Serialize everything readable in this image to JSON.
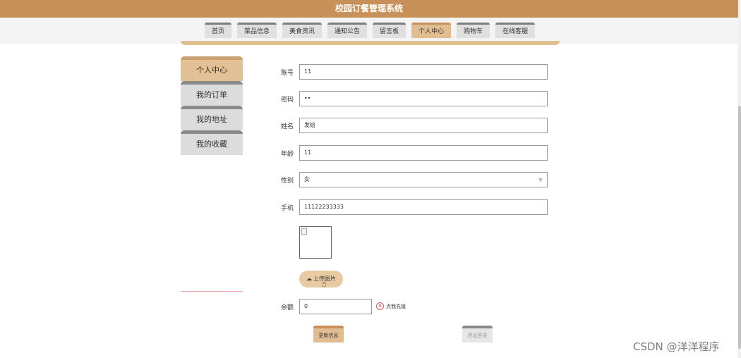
{
  "header": {
    "title": "校园订餐管理系统"
  },
  "nav": [
    {
      "label": "首页"
    },
    {
      "label": "菜品信息"
    },
    {
      "label": "美食资讯"
    },
    {
      "label": "通知公告"
    },
    {
      "label": "留言板"
    },
    {
      "label": "个人中心",
      "active": true
    },
    {
      "label": "购物车"
    },
    {
      "label": "在线客服"
    }
  ],
  "sidebar": [
    {
      "label": "个人中心",
      "active": true
    },
    {
      "label": "我的订单"
    },
    {
      "label": "我的地址"
    },
    {
      "label": "我的收藏"
    }
  ],
  "form": {
    "account": {
      "label": "账号",
      "value": "11"
    },
    "password": {
      "label": "密码",
      "value": "••"
    },
    "name": {
      "label": "姓名",
      "value": "发给"
    },
    "age": {
      "label": "年龄",
      "value": "11"
    },
    "gender": {
      "label": "性别",
      "value": "女"
    },
    "phone": {
      "label": "手机",
      "value": "11122233333"
    },
    "upload_label": "上传图片",
    "balance": {
      "label": "余额",
      "value": "0"
    },
    "recharge_label": "点我充值"
  },
  "actions": {
    "update_label": "更新信息",
    "logout_label": "退出登录"
  },
  "watermark": "CSDN @洋洋程序",
  "colors": {
    "header_bg": "#c9915a",
    "active_tab": "#e2bd92"
  },
  "icons": {
    "upload": "cloud-upload-icon",
    "recharge": "yen-icon",
    "select": "chevron-down-icon"
  }
}
